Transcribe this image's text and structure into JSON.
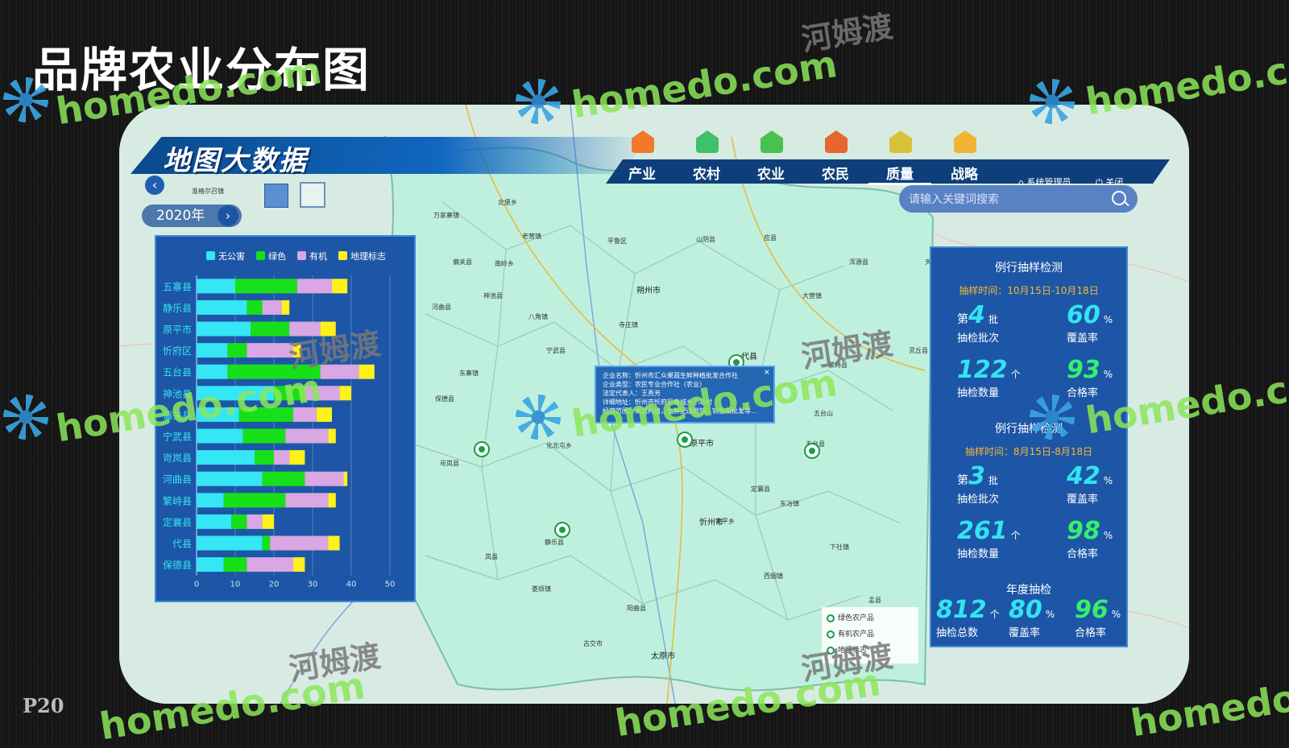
{
  "page": {
    "title": "品牌农业分布图",
    "page_number": "P20"
  },
  "header": {
    "app_title": "地图大数据",
    "nav": [
      {
        "label": "产业",
        "icon": "industry-icon",
        "color": "#f07a2a"
      },
      {
        "label": "农村",
        "icon": "village-icon",
        "color": "#3fc06a"
      },
      {
        "label": "农业",
        "icon": "agriculture-icon",
        "color": "#48c24f"
      },
      {
        "label": "农民",
        "icon": "farmer-icon",
        "color": "#e8652b"
      },
      {
        "label": "质量",
        "icon": "quality-icon",
        "color": "#d7c23a",
        "active": true
      },
      {
        "label": "战略",
        "icon": "strategy-icon",
        "color": "#f2b233"
      }
    ],
    "system_admin": "系统管理员",
    "close": "关闭"
  },
  "controls": {
    "year": "2020年",
    "search_placeholder": "请输入关键词搜索"
  },
  "chart_data": {
    "type": "bar",
    "orientation": "horizontal",
    "stacked": true,
    "categories": [
      "五寨县",
      "静乐县",
      "原平市",
      "忻府区",
      "五台县",
      "神池县",
      "偏关县",
      "宁武县",
      "岢岚县",
      "河曲县",
      "繁峙县",
      "定襄县",
      "代县",
      "保德县"
    ],
    "series": [
      {
        "name": "无公害",
        "color": "#35e6f5",
        "values": [
          10,
          13,
          14,
          8,
          8,
          20,
          11,
          12,
          15,
          17,
          7,
          9,
          17,
          7
        ]
      },
      {
        "name": "绿色",
        "color": "#18e018",
        "values": [
          16,
          4,
          10,
          5,
          24,
          8,
          14,
          11,
          5,
          11,
          16,
          4,
          2,
          6
        ]
      },
      {
        "name": "有机",
        "color": "#d8a7e4",
        "values": [
          9,
          5,
          8,
          12,
          10,
          9,
          6,
          11,
          4,
          10,
          11,
          4,
          15,
          12
        ]
      },
      {
        "name": "地理标志",
        "color": "#fff01c",
        "values": [
          4,
          2,
          4,
          2,
          4,
          3,
          4,
          2,
          4,
          1,
          2,
          3,
          3,
          3
        ]
      }
    ],
    "xlim": [
      0,
      50
    ],
    "xticks": [
      "0",
      "10",
      "20",
      "30",
      "40",
      "50"
    ],
    "legend_position": "top",
    "grid": true
  },
  "stats": {
    "section1": {
      "title": "例行抽样检测",
      "time": "抽样时间：10月15日-10月18日",
      "batch_prefix": "第",
      "batch": "4",
      "batch_unit": "批",
      "batch_label": "抽检批次",
      "coverage": "60",
      "coverage_unit": "%",
      "coverage_label": "覆盖率",
      "count": "122",
      "count_unit": "个",
      "count_label": "抽检数量",
      "pass": "93",
      "pass_unit": "%",
      "pass_label": "合格率"
    },
    "section2": {
      "title": "例行抽样检测",
      "time": "抽样时间：8月15日-8月18日",
      "batch_prefix": "第",
      "batch": "3",
      "batch_unit": "批",
      "batch_label": "抽检批次",
      "coverage": "42",
      "coverage_unit": "%",
      "coverage_label": "覆盖率",
      "count": "261",
      "count_unit": "个",
      "count_label": "抽检数量",
      "pass": "98",
      "pass_unit": "%",
      "pass_label": "合格率"
    },
    "annual": {
      "title": "年度抽检",
      "total": "812",
      "total_unit": "个",
      "total_label": "抽检总数",
      "coverage": "80",
      "coverage_unit": "%",
      "coverage_label": "覆盖率",
      "pass": "96",
      "pass_unit": "%",
      "pass_label": "合格率"
    }
  },
  "popup": {
    "lines": [
      "企业名称：忻州市汇众果蔬生鲜种植批发合作社",
      "企业类型：农民专业合作社（农业）",
      "法定代表人：王秀芳",
      "详细地址：忻州市忻府区秦城乡小站村",
      "经营范围：果蔬种植，生鲜配送供销，销售和批发等..."
    ],
    "close": "×"
  },
  "map": {
    "cities": [
      "朔州市",
      "忻州市",
      "太原市",
      "原平市",
      "代县"
    ],
    "places": [
      "准格尔召镇",
      "万家寨镇",
      "北堡乡",
      "老营镇",
      "偏关县",
      "南岭乡",
      "平鲁区",
      "神池县",
      "八角镇",
      "东寨镇",
      "宁武县",
      "化北屯乡",
      "静乐县",
      "岚县",
      "娄烦镇",
      "五台山",
      "繁峙县",
      "定襄县",
      "五台县",
      "东冶镇",
      "盂县",
      "阳曲县",
      "古交市",
      "西烟镇",
      "下社镇",
      "安平乡",
      "天镇",
      "山阴县",
      "应县",
      "浑源县",
      "灵丘县",
      "大营镇",
      "河曲县",
      "保德县",
      "岢岚县",
      "寺庄镇"
    ],
    "legend": [
      "绿色农产品",
      "有机农产品",
      "地理标志"
    ]
  },
  "watermarks": {
    "site": "homedo.com",
    "cn": "河姆渡"
  }
}
